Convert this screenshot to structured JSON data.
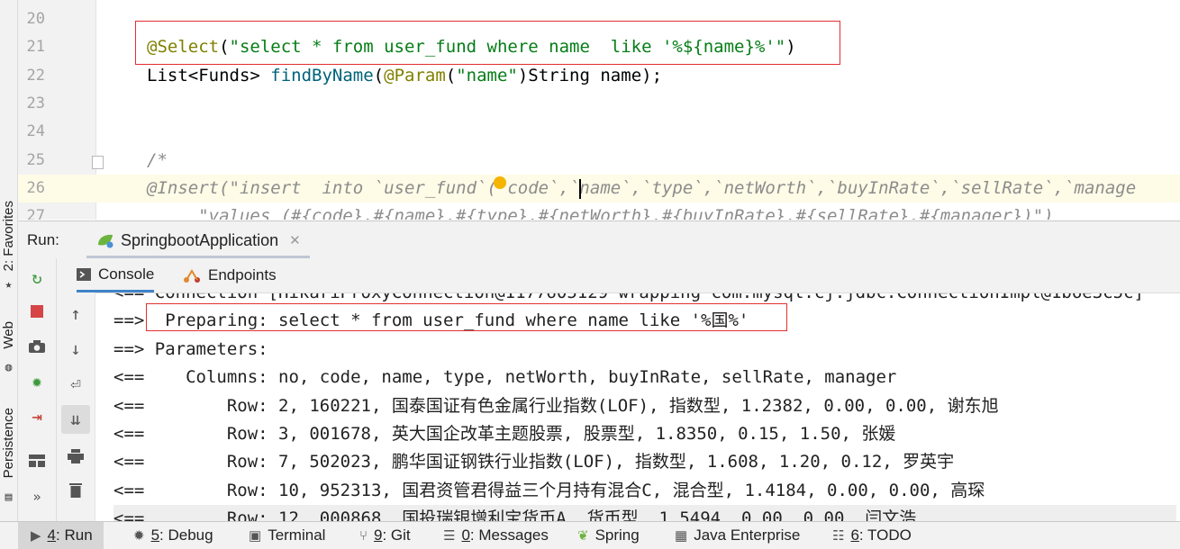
{
  "left_strip": {
    "favorites": "2: Favorites",
    "web": "Web",
    "persistence": "Persistence"
  },
  "editor": {
    "lines": [
      {
        "num": "20"
      },
      {
        "num": "21",
        "tokens": [
          {
            "t": "@Select",
            "c": "ann"
          },
          {
            "t": "(",
            "c": ""
          },
          {
            "t": "\"select * from user_fund where name  like '%${name}%'\"",
            "c": "str"
          },
          {
            "t": ")",
            "c": ""
          }
        ]
      },
      {
        "num": "22",
        "tokens": [
          {
            "t": "List<Funds> ",
            "c": ""
          },
          {
            "t": "findByName",
            "c": "fn"
          },
          {
            "t": "(",
            "c": ""
          },
          {
            "t": "@Param",
            "c": "ann"
          },
          {
            "t": "(",
            "c": ""
          },
          {
            "t": "\"name\"",
            "c": "str"
          },
          {
            "t": ")String name);",
            "c": ""
          }
        ]
      },
      {
        "num": "23"
      },
      {
        "num": "24"
      },
      {
        "num": "25",
        "tokens": [
          {
            "t": "/*",
            "c": "cmt"
          }
        ]
      },
      {
        "num": "26",
        "tokens": [
          {
            "t": "@Insert(\"insert  into `user_fund`(`code`,`name`,`type`,`netWorth`,`buyInRate`,`sellRate`,`manage",
            "c": "cmt"
          }
        ]
      },
      {
        "num": "27",
        "tokens": [
          {
            "t": "     \"values (#{code},#{name},#{type},#{netWorth},#{buyInRate},#{sellRate},#{manager})\")",
            "c": "cmt"
          }
        ]
      }
    ]
  },
  "run_panel": {
    "label": "Run:",
    "tab_name": "SpringbootApplication",
    "console_tab": "Console",
    "endpoints_tab": "Endpoints"
  },
  "console_lines": [
    "<== Connection [HikariProxyConnection@1177605129 wrapping com.mysql.cj.jdbc.ConnectionImpl@1b6e3c5c]",
    "==>  Preparing: select * from user_fund where name like '%国%'",
    "==> Parameters: ",
    "<==    Columns: no, code, name, type, netWorth, buyInRate, sellRate, manager",
    "<==        Row: 2, 160221, 国泰国证有色金属行业指数(LOF), 指数型, 1.2382, 0.00, 0.00, 谢东旭",
    "<==        Row: 3, 001678, 英大国企改革主题股票, 股票型, 1.8350, 0.15, 1.50, 张媛",
    "<==        Row: 7, 502023, 鹏华国证钢铁行业指数(LOF), 指数型, 1.608, 1.20, 0.12, 罗英宇",
    "<==        Row: 10, 952313, 国君资管君得益三个月持有混合C, 混合型, 1.4184, 0.00, 0.00, 高琛",
    "<==        Row: 12, 000868, 国投瑞银增利宝货币A, 货币型, 1.5494, 0.00, 0.00, 闫文浩"
  ],
  "bottom_bar": [
    {
      "key": "4",
      "label": ": Run",
      "icon": "run-icon"
    },
    {
      "key": "5",
      "label": ": Debug",
      "icon": "debug-icon"
    },
    {
      "key": "",
      "label": "Terminal",
      "icon": "terminal-icon"
    },
    {
      "key": "9",
      "label": ": Git",
      "icon": "git-icon"
    },
    {
      "key": "0",
      "label": ": Messages",
      "icon": "messages-icon"
    },
    {
      "key": "",
      "label": "Spring",
      "icon": "spring-icon"
    },
    {
      "key": "",
      "label": "Java Enterprise",
      "icon": "java-enterprise-icon"
    },
    {
      "key": "6",
      "label": ": TODO",
      "icon": "todo-icon"
    }
  ],
  "colors": {
    "annotation": "#808000",
    "string": "#067d17",
    "method": "#00627a",
    "comment": "#8c8c8c",
    "highlight_box": "#e0302f",
    "active_tab_underline": "#4083c9"
  }
}
